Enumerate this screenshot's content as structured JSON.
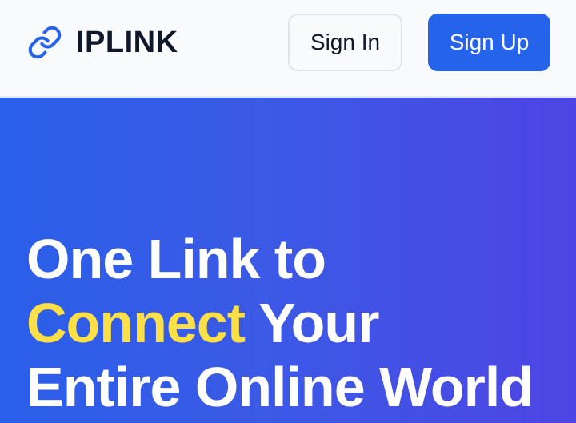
{
  "header": {
    "brand": {
      "name": "IPLINK",
      "icon": "link-icon",
      "icon_color": "#2563eb"
    },
    "signin_label": "Sign In",
    "signup_label": "Sign Up"
  },
  "hero": {
    "title_line1": "One Link to",
    "title_highlight": "Connect",
    "title_line2_rest": " Your",
    "title_line3": "Entire Online World",
    "highlight_color": "#fde047",
    "gradient_start": "#2a5fe9",
    "gradient_end": "#4d45e3"
  },
  "colors": {
    "primary": "#2563eb",
    "header_bg": "#f8fafc",
    "text_dark": "#0f172a"
  }
}
